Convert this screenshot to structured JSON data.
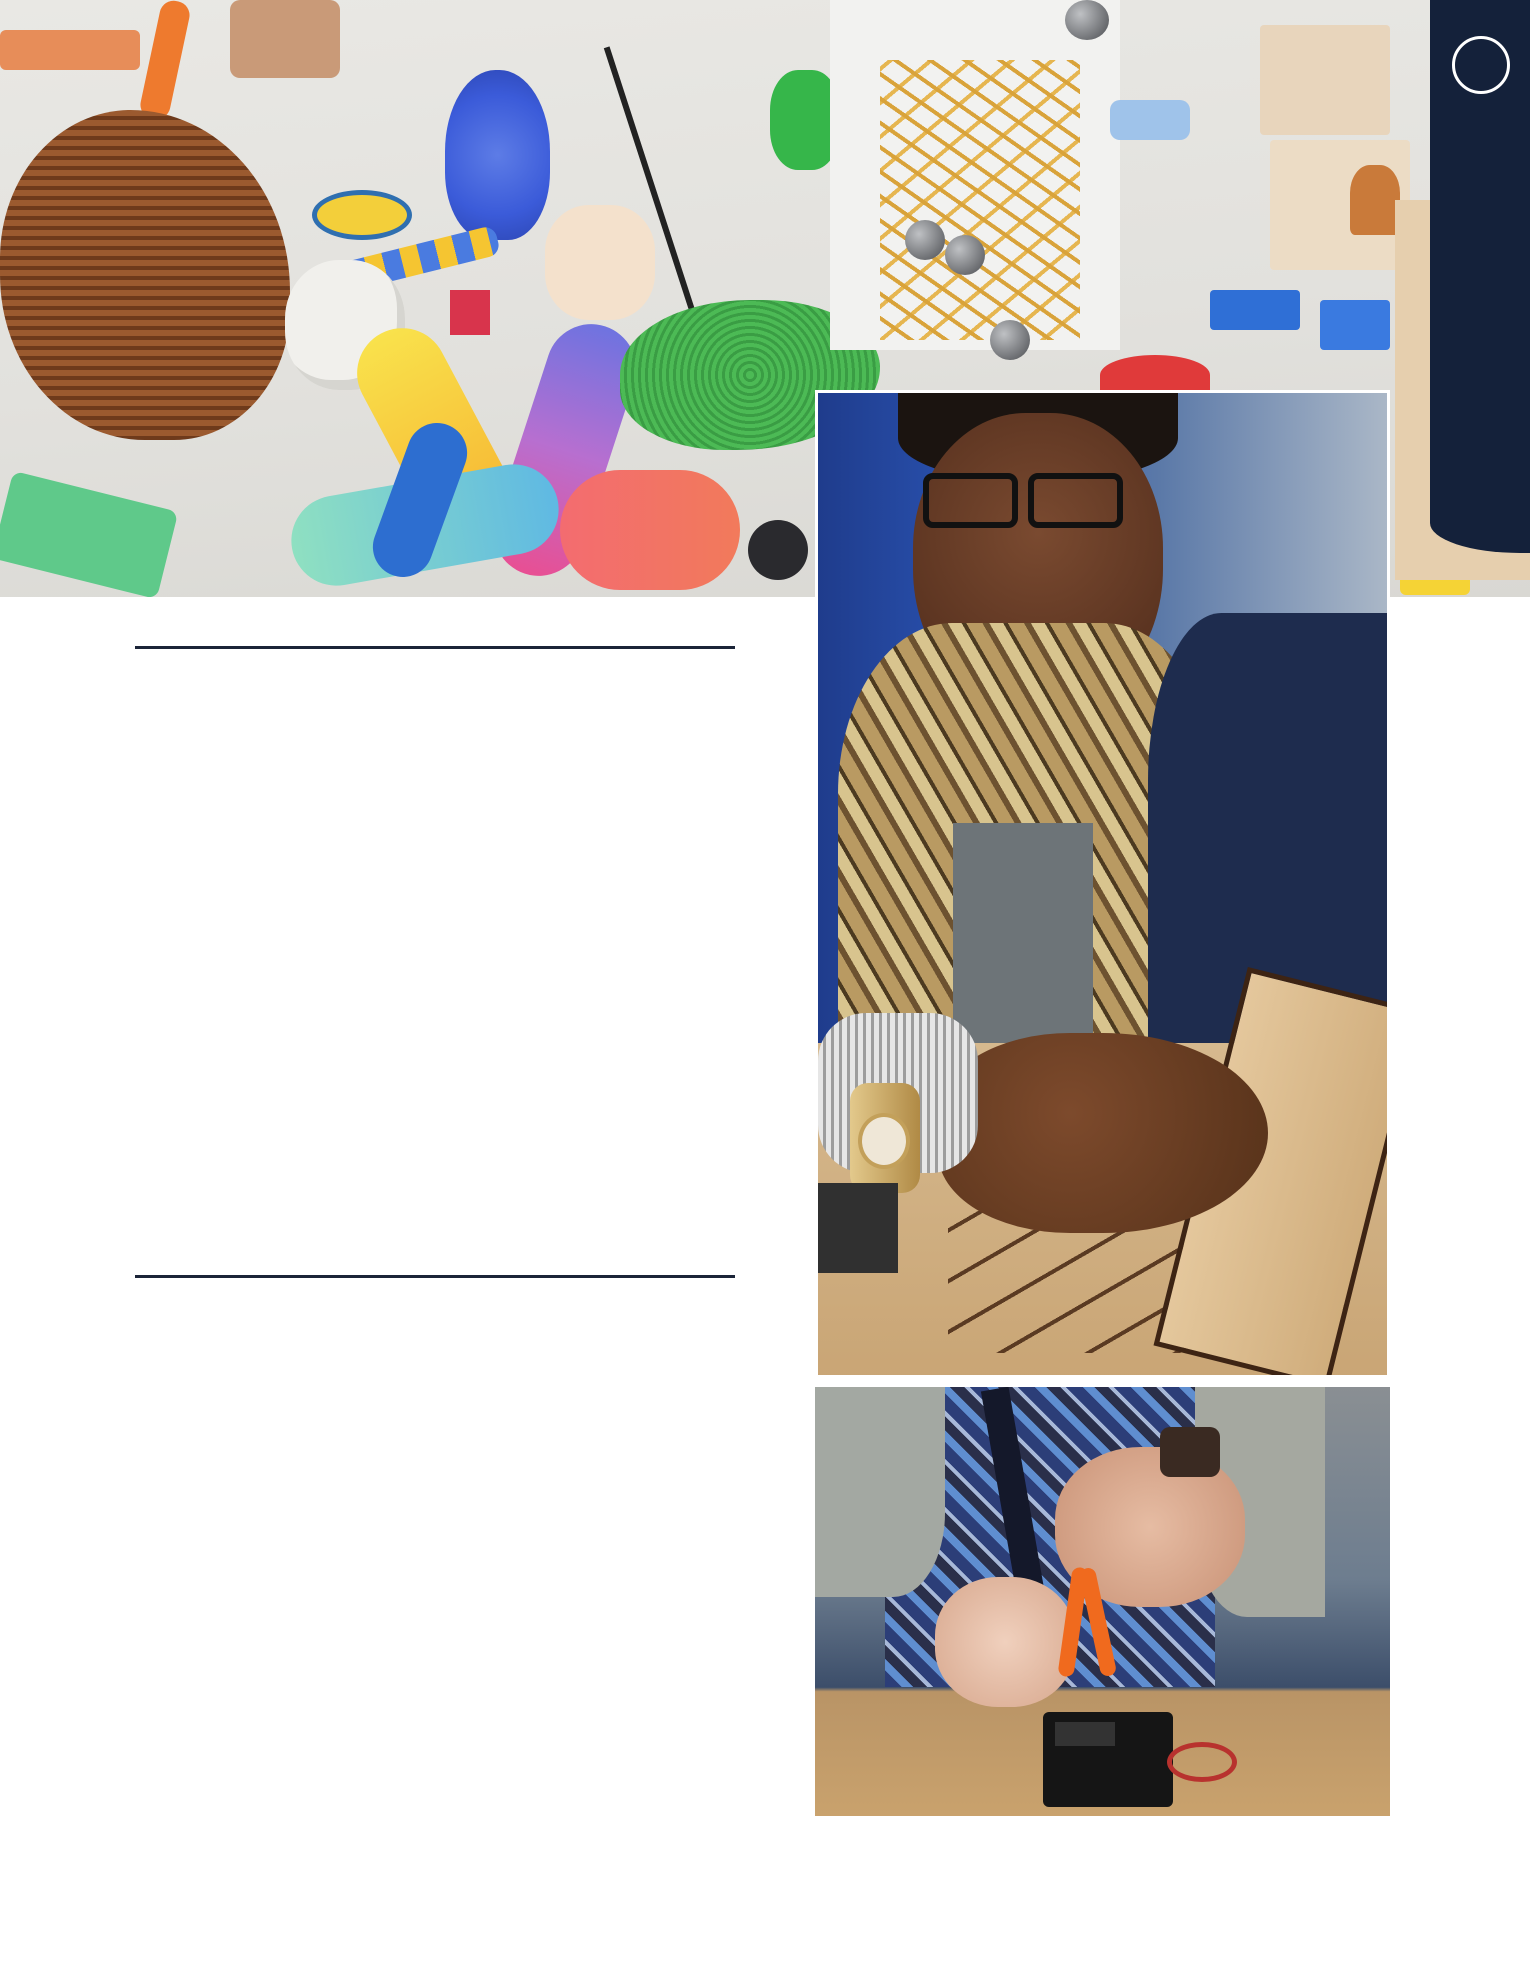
{
  "page": {
    "background": "#ffffff",
    "accent": "#14213a"
  },
  "photos": {
    "hero": {
      "subject": "3d-printed-objects-on-table"
    },
    "portrait": {
      "subject": "woman-assembling-laser-cut-wood-kit"
    },
    "hands": {
      "subject": "hands-with-pliers-and-servo-motor"
    }
  },
  "side_tab": {
    "color": "#14213a",
    "icon": "circle-outline-icon"
  },
  "text": {}
}
